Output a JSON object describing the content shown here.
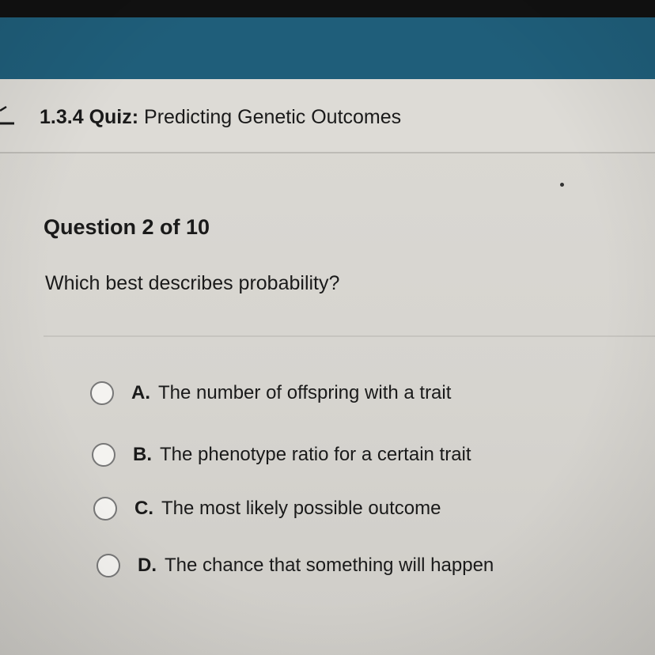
{
  "header": {
    "color": "#1f5e7a"
  },
  "title": {
    "number": "1.3.4",
    "kind": "Quiz:",
    "name": "Predicting Genetic Outcomes"
  },
  "question": {
    "number_label": "Question 2 of 10",
    "text": "Which best describes probability?"
  },
  "options": [
    {
      "letter": "A.",
      "text": "The number of offspring with a trait"
    },
    {
      "letter": "B.",
      "text": "The phenotype ratio for a certain trait"
    },
    {
      "letter": "C.",
      "text": "The most likely possible outcome"
    },
    {
      "letter": "D.",
      "text": "The chance that something will happen"
    }
  ]
}
